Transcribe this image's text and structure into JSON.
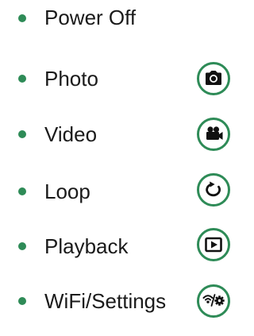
{
  "colors": {
    "accent": "#2e8b57",
    "text": "#1a1a1a",
    "icon": "#111111"
  },
  "menu": {
    "items": [
      {
        "label": "Power Off",
        "icon": ""
      },
      {
        "label": "Photo",
        "icon": "camera-icon"
      },
      {
        "label": "Video",
        "icon": "video-camera-icon"
      },
      {
        "label": "Loop",
        "icon": "loop-icon"
      },
      {
        "label": "Playback",
        "icon": "playback-icon"
      },
      {
        "label": "WiFi/Settings",
        "icon": "wifi-settings-icon"
      }
    ]
  }
}
